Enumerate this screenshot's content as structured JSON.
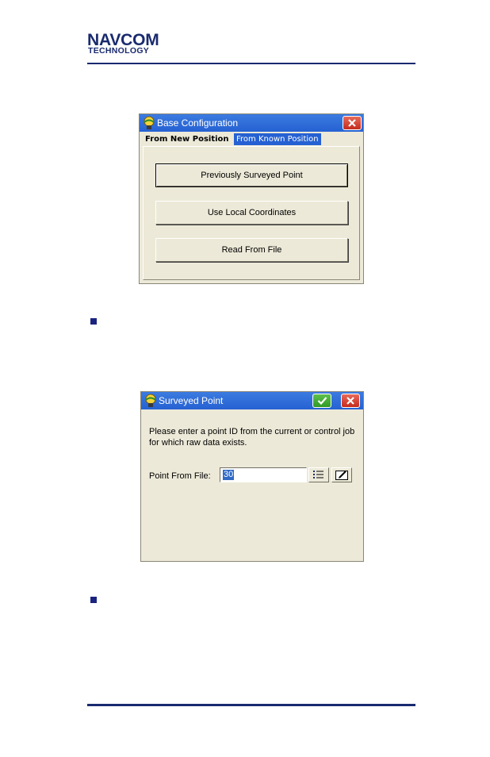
{
  "header": {
    "logo_main": "NAVCOM",
    "logo_sub": "TECHNOLOGY"
  },
  "dialog1": {
    "title": "Base Configuration",
    "tabs": [
      "From New Position",
      "From Known Position"
    ],
    "buttons": [
      "Previously Surveyed Point",
      "Use Local Coordinates",
      "Read From File"
    ]
  },
  "dialog2": {
    "title": "Surveyed Point",
    "prompt": "Please enter a point ID from the current or control job for which raw data exists.",
    "field_label": "Point From File:",
    "field_value": "30"
  },
  "icons": [
    "app-icon",
    "close-icon",
    "ok-check-icon",
    "list-icon",
    "edit-icon",
    "bullet-square"
  ],
  "colors": {
    "brand_navy": "#1a2a6e",
    "titlebar_blue": "#2561d2",
    "dialog_bg": "#ece9d8",
    "close_red": "#c42b1c",
    "ok_green": "#2f9a25"
  }
}
